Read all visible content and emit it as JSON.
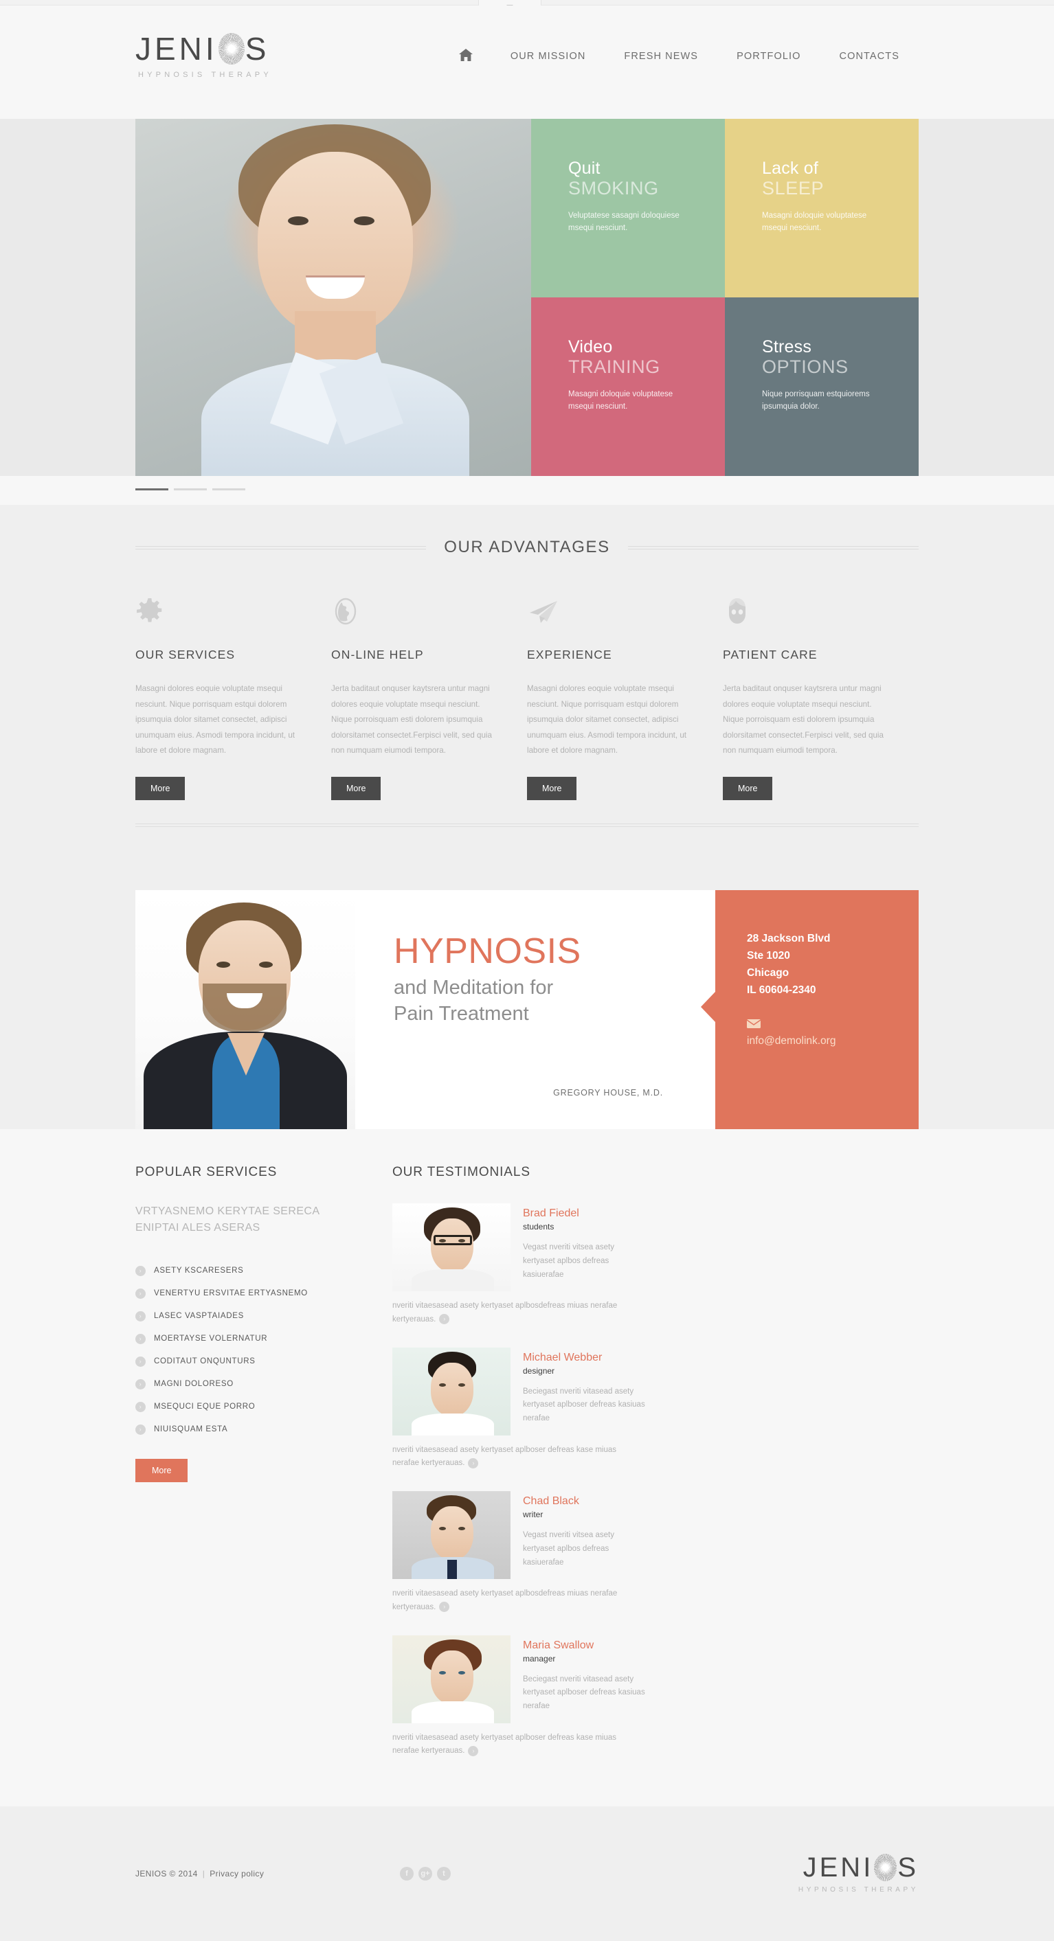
{
  "brand": {
    "name": "JENIOS",
    "tagline": "HYPNOSIS THERAPY",
    "accent": "#e0755c"
  },
  "nav": {
    "home_icon": "home-icon",
    "items": [
      {
        "label": "OUR MISSION"
      },
      {
        "label": "FRESH NEWS"
      },
      {
        "label": "PORTFOLIO"
      },
      {
        "label": "CONTACTS"
      }
    ]
  },
  "hero": {
    "tiles": [
      {
        "title_light": "Quit",
        "title_bold": "SMOKING",
        "text": "Veluptatese sasagni doloquiese msequi nesciunt.",
        "color": "#9dc6a4"
      },
      {
        "title_light": "Lack of",
        "title_bold": "SLEEP",
        "text": "Masagni doloquie voluptatese msequi nesciunt.",
        "color": "#e6d288"
      },
      {
        "title_light": "Video",
        "title_bold": "TRAINING",
        "text": "Masagni doloquie voluptatese msequi nesciunt.",
        "color": "#d2697c"
      },
      {
        "title_light": "Stress",
        "title_bold": "OPTIONS",
        "text": "Nique porrisquam estquiorems ipsumquia dolor.",
        "color": "#69797f"
      }
    ],
    "slides": [
      "1",
      "2",
      "3"
    ],
    "active_slide": 0
  },
  "advantages": {
    "heading": "OUR ADVANTAGES",
    "items": [
      {
        "icon": "gear-icon",
        "title": "OUR SERVICES",
        "text": "Masagni dolores eoquie voluptate msequi nesciunt. Nique porrisquam estqui dolorem ipsumquia dolor sitamet consectet, adipisci unumquam eius. Asmodi tempora incidunt, ut labore et dolore magnam.",
        "button": "More"
      },
      {
        "icon": "globe-icon",
        "title": "ON-LINE HELP",
        "text": "Jerta baditaut onquser kaytsrera untur magni dolores eoquie voluptate msequi nesciunt. Nique porroisquam esti dolorem ipsumquia dolorsitamet consectet.Ferpisci velit, sed quia non numquam eiumodi tempora.",
        "button": "More"
      },
      {
        "icon": "paper-plane-icon",
        "title": "EXPERIENCE",
        "text": "Masagni dolores eoquie voluptate msequi nesciunt. Nique porrisquam estqui dolorem ipsumquia dolor sitamet consectet, adipisci unumquam eius. Asmodi tempora incidunt, ut labore et dolore magnam.",
        "button": "More"
      },
      {
        "icon": "person-icon",
        "title": "PATIENT CARE",
        "text": "Jerta baditaut onquser kaytsrera untur magni dolores eoquie voluptate msequi nesciunt. Nique porroisquam esti dolorem ipsumquia dolorsitamet consectet.Ferpisci velit, sed quia non numquam eiumodi tempora.",
        "button": "More"
      }
    ]
  },
  "promo": {
    "title": "HYPNOSIS",
    "subtitle_line1": "and Meditation for",
    "subtitle_line2": "Pain Treatment",
    "byline": "GREGORY HOUSE, M.D.",
    "address_line1": "28 Jackson Blvd",
    "address_line2": "Ste 1020",
    "address_line3": "Chicago",
    "address_line4": "IL 60604-2340",
    "mail_icon": "envelope-icon",
    "email": "info@demolink.org"
  },
  "services": {
    "heading": "POPULAR SERVICES",
    "lead_line1": "VRTYASNEMO KERYTAE SERECA",
    "lead_line2": "ENIPTAI ALES ASERAS",
    "items": [
      {
        "label": "ASETY KSCARESERS"
      },
      {
        "label": "VENERTYU ERSVITAE ERTYASNEMO"
      },
      {
        "label": "LASEC VASPTAIADES"
      },
      {
        "label": "MOERTAYSE VOLERNATUR"
      },
      {
        "label": "CODITAUT ONQUNTURS"
      },
      {
        "label": "MAGNI DOLORESO"
      },
      {
        "label": "MSEQUCI EQUE PORRO"
      },
      {
        "label": "NIUISQUAM ESTA"
      }
    ],
    "button": "More"
  },
  "testimonials": {
    "heading": "OUR TESTIMONIALS",
    "items": [
      {
        "name": "Brad Fiedel",
        "role": "students",
        "quote": "Vegast nveriti vitsea asety kertyaset aplbos defreas kasiuerafae",
        "footer": "nveriti vitaesasead asety kertyaset aplbosdefreas miuas nerafae kertyerauas."
      },
      {
        "name": "Michael Webber",
        "role": "designer",
        "quote": "Beciegast nveriti vitasead asety kertyaset aplboser defreas kasiuas nerafae",
        "footer": "nveriti vitaesasead asety kertyaset aplboser defreas kase miuas nerafae kertyerauas."
      },
      {
        "name": "Chad Black",
        "role": "writer",
        "quote": "Vegast nveriti vitsea asety kertyaset aplbos defreas kasiuerafae",
        "footer": "nveriti vitaesasead asety kertyaset aplbosdefreas miuas nerafae kertyerauas."
      },
      {
        "name": "Maria Swallow",
        "role": "manager",
        "quote": "Beciegast nveriti vitasead asety kertyaset aplboser defreas kasiuas nerafae",
        "footer": "nveriti vitaesasead asety kertyaset aplboser defreas kase miuas nerafae kertyerauas."
      }
    ]
  },
  "footer": {
    "copyright": "JENIOS © 2014",
    "privacy": "Privacy policy",
    "socials": [
      {
        "glyph": "f",
        "name": "facebook-icon"
      },
      {
        "glyph": "g+",
        "name": "google-plus-icon"
      },
      {
        "glyph": "t",
        "name": "twitter-icon"
      }
    ]
  }
}
